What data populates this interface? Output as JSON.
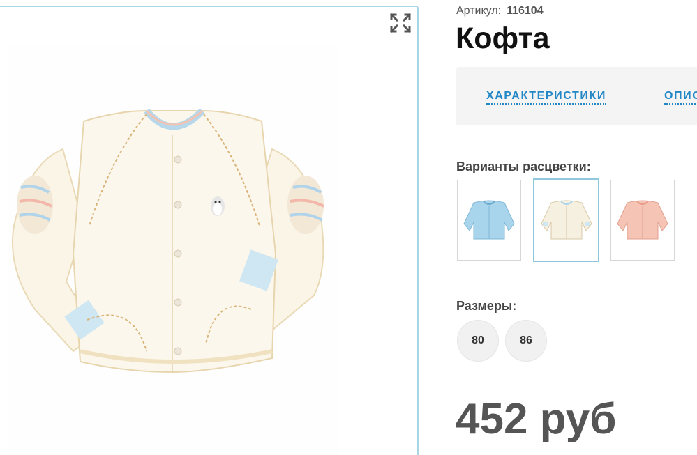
{
  "product": {
    "sku_label": "Артикул:",
    "sku_value": "116104",
    "title": "Кофта",
    "main_image_icon": "cardigan-photo",
    "fullscreen_icon": "expand-icon"
  },
  "tabs": [
    {
      "label": "ХАРАКТЕРИСТИКИ"
    },
    {
      "label": "ОПИСАНИЕ"
    }
  ],
  "colors": {
    "label": "Варианты расцветки:",
    "variants": [
      {
        "icon": "cardigan-blue-thumbnail",
        "color": "#a8d4ec",
        "selected": false
      },
      {
        "icon": "cardigan-cream-thumbnail",
        "color": "#f6f0e0",
        "selected": true
      },
      {
        "icon": "cardigan-peach-thumbnail",
        "color": "#f6c4b4",
        "selected": false
      }
    ]
  },
  "sizes": {
    "label": "Размеры:",
    "options": [
      "80",
      "86"
    ]
  },
  "price": "452 руб",
  "theme": {
    "accent": "#2387c6",
    "gallery_border": "#a9d6e5"
  }
}
